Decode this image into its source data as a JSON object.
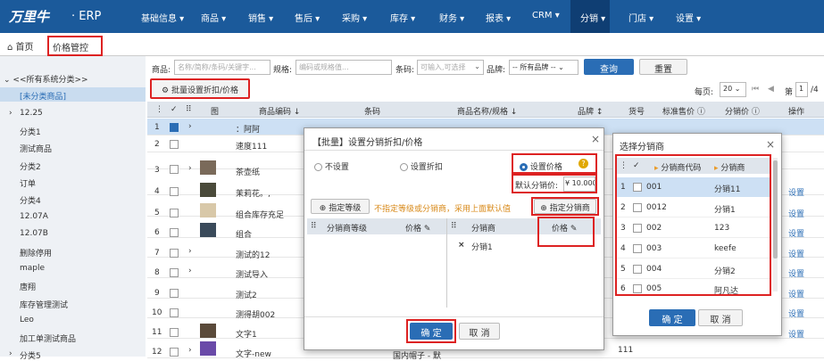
{
  "header": {
    "logo": "万里牛",
    "logo_sub": "· ERP",
    "nav": [
      "基础信息",
      "商品",
      "销售",
      "售后",
      "采购",
      "库存",
      "财务",
      "报表",
      "CRM",
      "分销",
      "门店",
      "设置"
    ],
    "nav_active": "分销"
  },
  "tabs": {
    "home": "首页",
    "current": "价格管控",
    "close": "×"
  },
  "sidebar": {
    "root": "<<所有系统分类>>",
    "items": [
      "[未分类商品]",
      "12.25",
      "分类1",
      "测试商品",
      "分类2",
      "订单",
      "分类4",
      "12.07A",
      "12.07B",
      "删除停用",
      "maple",
      "唐翔",
      "库存管理测试",
      "Leo",
      "加工单测试商品",
      "分类5"
    ]
  },
  "filter": {
    "product_label": "商品:",
    "product_placeholder": "名称/简称/条码/关键字...",
    "spec_label": "规格:",
    "spec_placeholder": "编码或规格值...",
    "barcode_label": "条码:",
    "barcode_placeholder": "可输入,可选择",
    "brand_label": "品牌:",
    "brand_value": "-- 所有品牌 --",
    "query": "查询",
    "reset": "重置"
  },
  "toolbar": {
    "batch": "批量设置折扣/价格",
    "per_page_label": "每页:",
    "per_page": "20",
    "page_label": "第",
    "page": "1",
    "page_total": "/4"
  },
  "table": {
    "headers": [
      "",
      "",
      "",
      "图",
      "商品编码 ↓",
      "条码",
      "商品名称/规格 ↓",
      "品牌 ↕",
      "货号",
      "标准售价 ⓘ",
      "分销价 ⓘ",
      "操作"
    ],
    "rows": [
      {
        "no": "1",
        "code": "：阿阿",
        "checked": true,
        "arrow": "›",
        "thumb": ""
      },
      {
        "no": "2",
        "code": "速度111",
        "checked": false,
        "arrow": "",
        "thumb": ""
      },
      {
        "no": "3",
        "code": "茶壶纸",
        "checked": false,
        "arrow": "›",
        "thumb": "#7a6a5a"
      },
      {
        "no": "4",
        "code": "茉莉花。,",
        "checked": false,
        "arrow": "",
        "thumb": "#4a4a3a"
      },
      {
        "no": "5",
        "code": "组合库存充足",
        "checked": false,
        "arrow": "",
        "thumb": "#d8c8a8"
      },
      {
        "no": "6",
        "code": "组合",
        "checked": false,
        "arrow": "",
        "thumb": "#3a4a5a"
      },
      {
        "no": "7",
        "code": "测试的12",
        "checked": false,
        "arrow": "›",
        "thumb": ""
      },
      {
        "no": "8",
        "code": "测试导入",
        "checked": false,
        "arrow": "›",
        "thumb": ""
      },
      {
        "no": "9",
        "code": "测试2",
        "checked": false,
        "arrow": "",
        "thumb": ""
      },
      {
        "no": "10",
        "code": "测得胡002",
        "checked": false,
        "arrow": "",
        "thumb": ""
      },
      {
        "no": "11",
        "code": "文字1",
        "checked": false,
        "arrow": "",
        "thumb": "#5a4a3a"
      },
      {
        "no": "12",
        "code": "文字-new",
        "checked": false,
        "arrow": "›",
        "thumb": "#6a4aa8"
      }
    ],
    "op_label": "设置",
    "row12_hidden": "国内帽子 - 默",
    "row12_sku": "111"
  },
  "modal": {
    "title": "【批量】设置分销折扣/价格",
    "close": "×",
    "radio_none": "不设置",
    "radio_discount": "设置折扣",
    "radio_price": "设置价格",
    "help": "?",
    "default_label": "默认分销价:",
    "default_value": "¥ 10.000",
    "assign_level": "指定等级",
    "hint": "不指定等级或分销商，采用上面默认值",
    "assign_dist": "指定分销商",
    "left_headers": [
      "分销商等级",
      "价格 ✎"
    ],
    "right_headers": [
      "分销商",
      "价格 ✎"
    ],
    "right_row": "分销1",
    "remove": "×",
    "confirm": "确 定",
    "cancel": "取 消"
  },
  "modal2": {
    "title": "选择分销商",
    "close": "×",
    "headers": [
      "分销商代码",
      "分销商"
    ],
    "rows": [
      {
        "no": "1",
        "code": "001",
        "name": "分销11"
      },
      {
        "no": "2",
        "code": "0012",
        "name": "分销1"
      },
      {
        "no": "3",
        "code": "002",
        "name": "123"
      },
      {
        "no": "4",
        "code": "003",
        "name": "keefe"
      },
      {
        "no": "5",
        "code": "004",
        "name": "分销2"
      },
      {
        "no": "6",
        "code": "005",
        "name": "阿凡达"
      }
    ],
    "confirm": "确 定",
    "cancel": "取 消"
  },
  "colors": {
    "nav": "#1b5a9b",
    "nav_active": "#0f3e73",
    "accent": "#2a6db5",
    "highlight": "#d22222"
  }
}
